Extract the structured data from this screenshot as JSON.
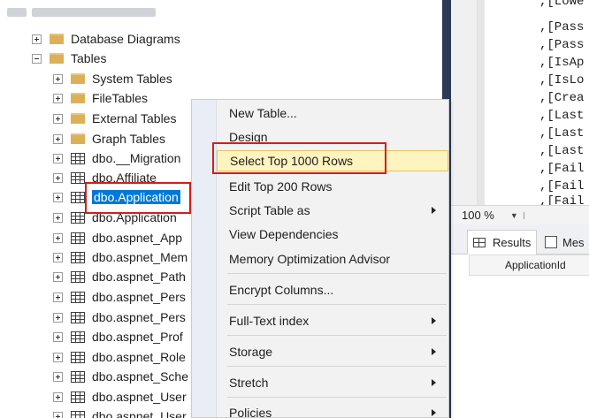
{
  "explorer": {
    "folders": [
      {
        "label": "Database Diagrams",
        "expanded": false
      },
      {
        "label": "Tables",
        "expanded": true
      }
    ],
    "subfolders": [
      "System Tables",
      "FileTables",
      "External Tables",
      "Graph Tables"
    ],
    "tables": [
      "dbo.__Migration",
      "dbo.Affiliate",
      "dbo.Application",
      "dbo.Application",
      "dbo.aspnet_App",
      "dbo.aspnet_Mem",
      "dbo.aspnet_Path",
      "dbo.aspnet_Pers",
      "dbo.aspnet_Pers",
      "dbo.aspnet_Prof",
      "dbo.aspnet_Role",
      "dbo.aspnet_Sche",
      "dbo.aspnet_User",
      "dbo.aspnet_User"
    ],
    "selected_table_index": 2
  },
  "context_menu": {
    "items": [
      {
        "label": "New Table...",
        "submenu": false
      },
      {
        "label": "Design",
        "submenu": false
      },
      {
        "label": "Select Top 1000 Rows",
        "submenu": false,
        "hover": true
      },
      {
        "label": "Edit Top 200 Rows",
        "submenu": false
      },
      {
        "label": "Script Table as",
        "submenu": true
      },
      {
        "label": "View Dependencies",
        "submenu": false
      },
      {
        "label": "Memory Optimization Advisor",
        "submenu": false
      },
      {
        "label": "Encrypt Columns...",
        "submenu": false
      },
      {
        "label": "Full-Text index",
        "submenu": true
      },
      {
        "label": "Storage",
        "submenu": true
      },
      {
        "label": "Stretch",
        "submenu": true
      },
      {
        "label": "Policies",
        "submenu": true
      }
    ]
  },
  "editor": {
    "code_lines": [
      ",[Lowe",
      ",[Pass",
      ",[Pass",
      ",[IsAp",
      ",[IsLo",
      ",[Crea",
      ",[Last",
      ",[Last",
      ",[Last",
      ",[Fail",
      ",[Fail",
      ",[Fail"
    ],
    "zoom": "100 %",
    "tabs": {
      "results": "Results",
      "messages": "Mes"
    },
    "column_header": "ApplicationId"
  },
  "colors": {
    "selection": "#0078d7",
    "highlight_border": "#d0201a",
    "menu_hover_bg": "#fdf4bf",
    "editor_sidebar": "#2b3a55"
  }
}
